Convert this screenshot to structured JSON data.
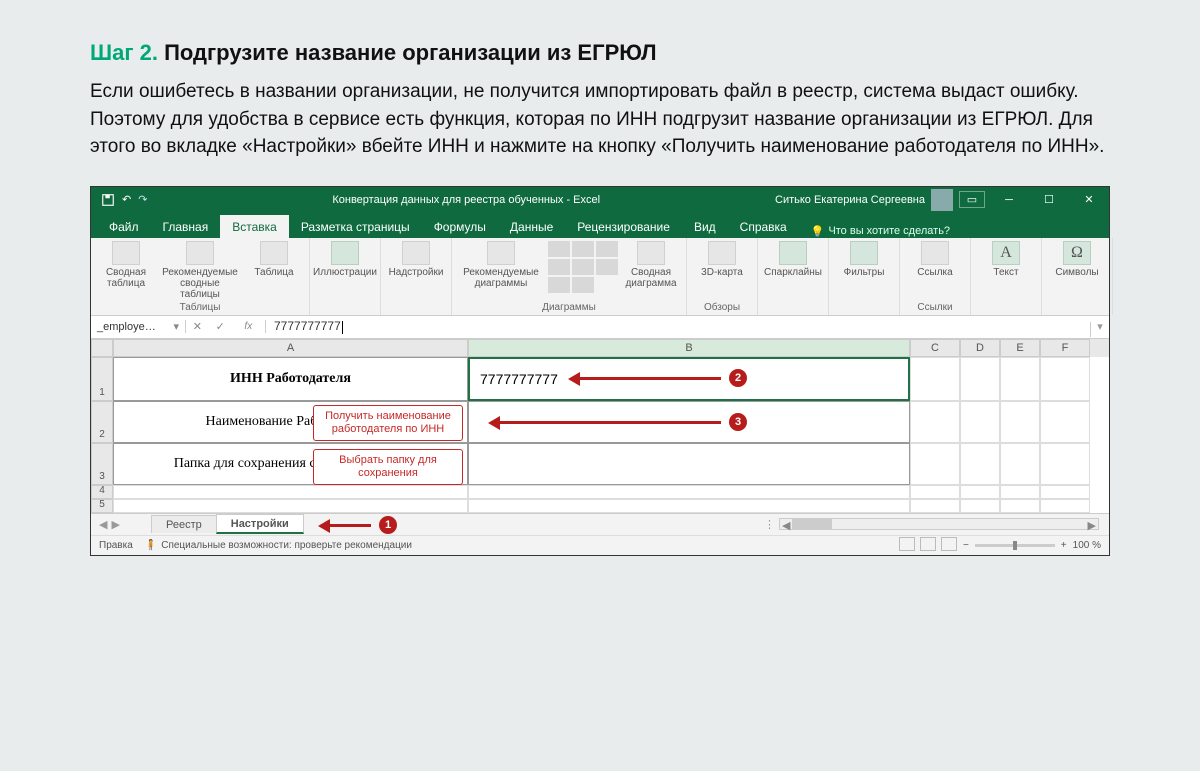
{
  "doc": {
    "step_label": "Шаг 2.",
    "heading": " Подгрузите название организации из ЕГРЮЛ",
    "paragraph": "Если ошибетесь в названии организации, не получится импортировать файл в реестр, система выдаст ошибку. Поэтому для удобства в сервисе есть функция, которая по ИНН подгрузит название организации из ЕГРЮЛ. Для этого во вкладке «Настройки» вбейте ИНН и нажмите на кнопку «Получить наименование работодателя по ИНН»."
  },
  "excel": {
    "title": "Конвертация данных для реестра обученных  -  Excel",
    "user": "Ситько Екатерина Сергеевна",
    "tabs": [
      "Файл",
      "Главная",
      "Вставка",
      "Разметка страницы",
      "Формулы",
      "Данные",
      "Рецензирование",
      "Вид",
      "Справка"
    ],
    "active_tab": "Вставка",
    "tell_me": "Что вы хотите сделать?",
    "ribbon": {
      "groups": [
        {
          "label": "Таблицы",
          "buttons": [
            {
              "t": "Сводная таблица"
            },
            {
              "t": "Рекомендуемые сводные таблицы",
              "w": true
            },
            {
              "t": "Таблица"
            }
          ]
        },
        {
          "label": "",
          "buttons": [
            {
              "t": "Иллюстрации"
            }
          ]
        },
        {
          "label": "",
          "buttons": [
            {
              "t": "Надстройки"
            }
          ]
        },
        {
          "label": "Диаграммы",
          "buttons": [
            {
              "t": "Рекомендуемые диаграммы",
              "w": true
            },
            {
              "t": "",
              "icon_grid": true
            },
            {
              "t": "Сводная диаграмма"
            }
          ]
        },
        {
          "label": "Обзоры",
          "buttons": [
            {
              "t": "3D-карта"
            }
          ]
        },
        {
          "label": "",
          "buttons": [
            {
              "t": "Спарклайны"
            }
          ]
        },
        {
          "label": "",
          "buttons": [
            {
              "t": "Фильтры"
            }
          ]
        },
        {
          "label": "Ссылки",
          "buttons": [
            {
              "t": "Ссылка"
            }
          ]
        },
        {
          "label": "",
          "buttons": [
            {
              "t": "Текст"
            }
          ]
        },
        {
          "label": "",
          "buttons": [
            {
              "t": "Символы"
            }
          ]
        }
      ]
    },
    "namebox": "_employe…",
    "formula": "7777777777",
    "columns": [
      "A",
      "B",
      "C",
      "D",
      "E",
      "F"
    ],
    "cells": {
      "a1": "ИНН Работодателя",
      "b1": "7777777777",
      "a2": "Наименование Работодателя",
      "a3": "Папка для сохранения созданных XML"
    },
    "cell_buttons": {
      "btn1": "Получить наименование работодателя по ИНН",
      "btn2": "Выбрать папку для сохранения"
    },
    "sheet_tabs": [
      "Реестр",
      "Настройки"
    ],
    "active_sheet": "Настройки",
    "status": {
      "mode": "Правка",
      "a11y": "Специальные возможности: проверьте рекомендации",
      "zoom": "100 %"
    },
    "badges": {
      "b1": "1",
      "b2": "2",
      "b3": "3"
    }
  }
}
